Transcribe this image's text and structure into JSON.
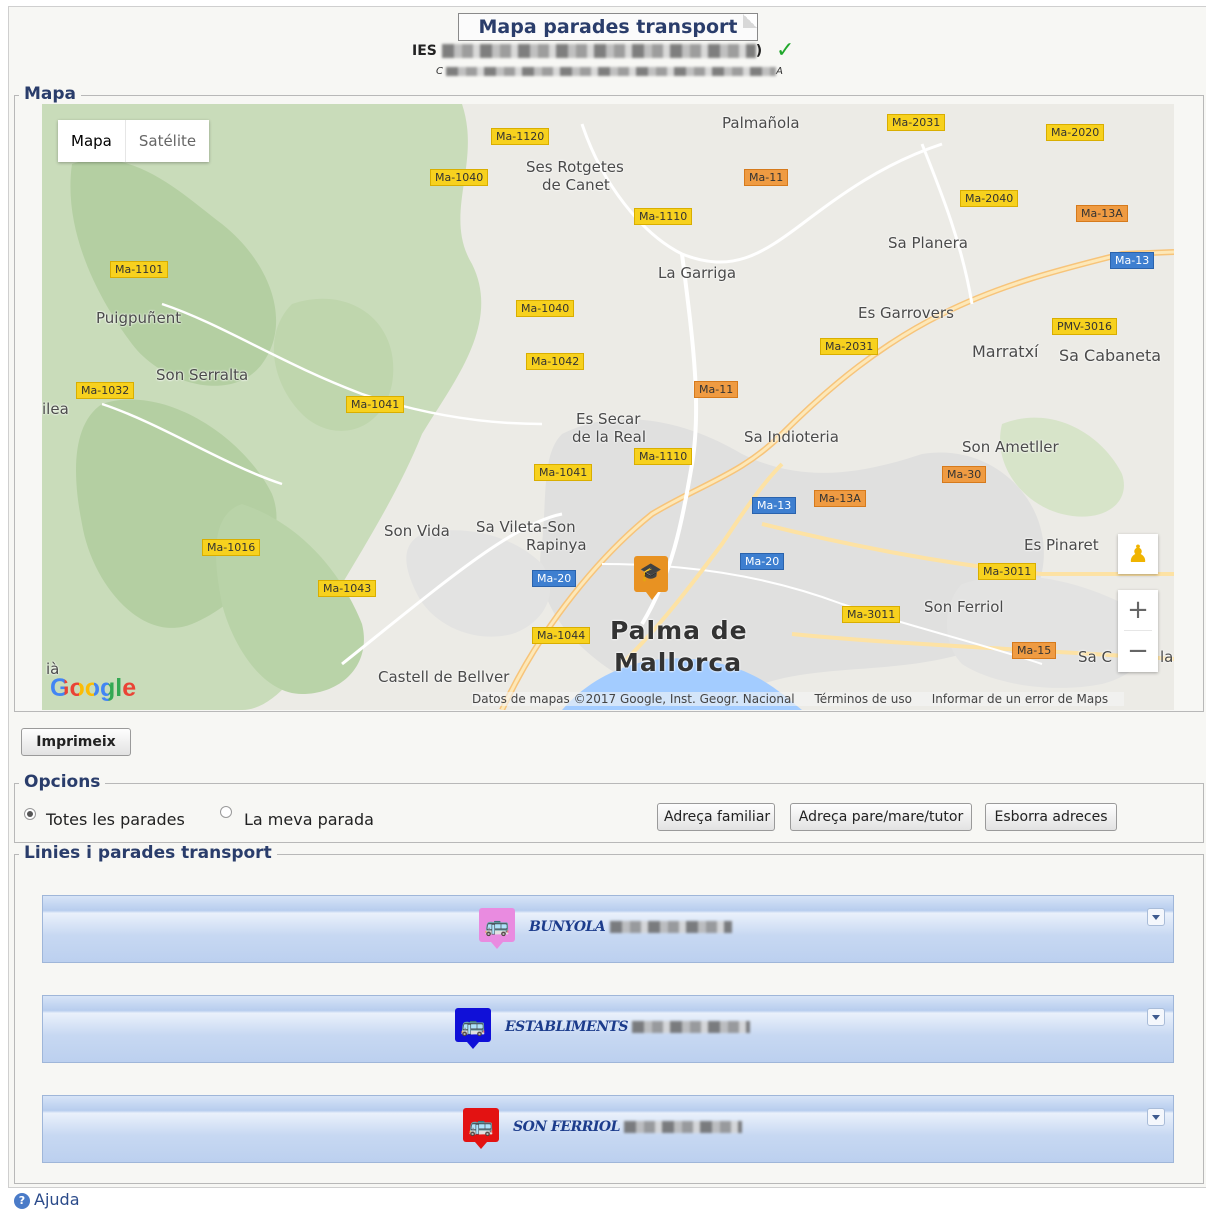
{
  "header": {
    "title": "Mapa parades transport",
    "school_prefix": "IES",
    "school_suffix": ")",
    "subtitle_prefix": "C",
    "subtitle_suffix": "A"
  },
  "map_section": {
    "legend": "Mapa",
    "map_types": [
      "Mapa",
      "Satélite"
    ],
    "places": {
      "palmanyola": "Palmañola",
      "rotgetes": "Ses Rotgetes",
      "rotgetes2": "de Canet",
      "sa_planera": "Sa Planera",
      "la_garriga": "La Garriga",
      "puigpunyent": "Puigpuñent",
      "es_garrovers": "Es Garrovers",
      "marratxi": "Marratxí",
      "sa_cabaneta": "Sa Cabaneta",
      "son_serralta": "Son Serralta",
      "ilea": "ilea",
      "es_secar": "Es Secar",
      "es_secar2": "de la Real",
      "sa_indioteria": "Sa Indioteria",
      "son_ametller": "Son Ametller",
      "son_vida": "Son Vida",
      "sa_vileta": "Sa Vileta-Son",
      "sa_vileta2": "Rapinya",
      "es_pinaret": "Es Pinaret",
      "son_ferriol": "Son Ferriol",
      "palma": "Palma de",
      "palma2": "Mallorca",
      "castell": "Castell de Bellver",
      "sa_c": "Sa C",
      "la": "la",
      "ia": "ià"
    },
    "roads": {
      "r1120": "Ma-1120",
      "r2031a": "Ma-2031",
      "r2020": "Ma-2020",
      "r1040a": "Ma-1040",
      "r11a": "Ma-11",
      "r1110a": "Ma-1110",
      "r2040": "Ma-2040",
      "r13a": "Ma-13A",
      "r13": "Ma-13",
      "r1101": "Ma-1101",
      "r1040b": "Ma-1040",
      "pmv3016": "PMV-3016",
      "r2031b": "Ma-2031",
      "r1042": "Ma-1042",
      "r1032": "Ma-1032",
      "r1041a": "Ma-1041",
      "r11b": "Ma-11",
      "r30": "Ma-30",
      "r1041b": "Ma-1041",
      "r1110b": "Ma-1110",
      "r13b": "Ma-13",
      "r13ab": "Ma-13A",
      "r1016": "Ma-1016",
      "r20a": "Ma-20",
      "r20b": "Ma-20",
      "r3011a": "Ma-3011",
      "r1043": "Ma-1043",
      "r3011b": "Ma-3011",
      "r1044": "Ma-1044",
      "r15": "Ma-15"
    },
    "attribution": [
      "Datos de mapas ©2017 Google, Inst. Geogr. Nacional",
      "Términos de uso",
      "Informar de un error de Maps"
    ],
    "google_logo": "Google"
  },
  "print_button": "Imprimeix",
  "options": {
    "legend": "Opcions",
    "radio_all": "Totes les parades",
    "radio_mine": "La meva parada",
    "btn_family": "Adreça familiar",
    "btn_parent": "Adreça pare/mare/tutor",
    "btn_clear": "Esborra adreces"
  },
  "lines": {
    "legend": "Linies i parades transport",
    "items": [
      {
        "name": "BUNYOLA",
        "color": "#e98be0"
      },
      {
        "name": "ESTABLIMENTS",
        "color": "#1010d8"
      },
      {
        "name": "SON FERRIOL",
        "color": "#e31212"
      }
    ]
  },
  "help": "Ajuda"
}
